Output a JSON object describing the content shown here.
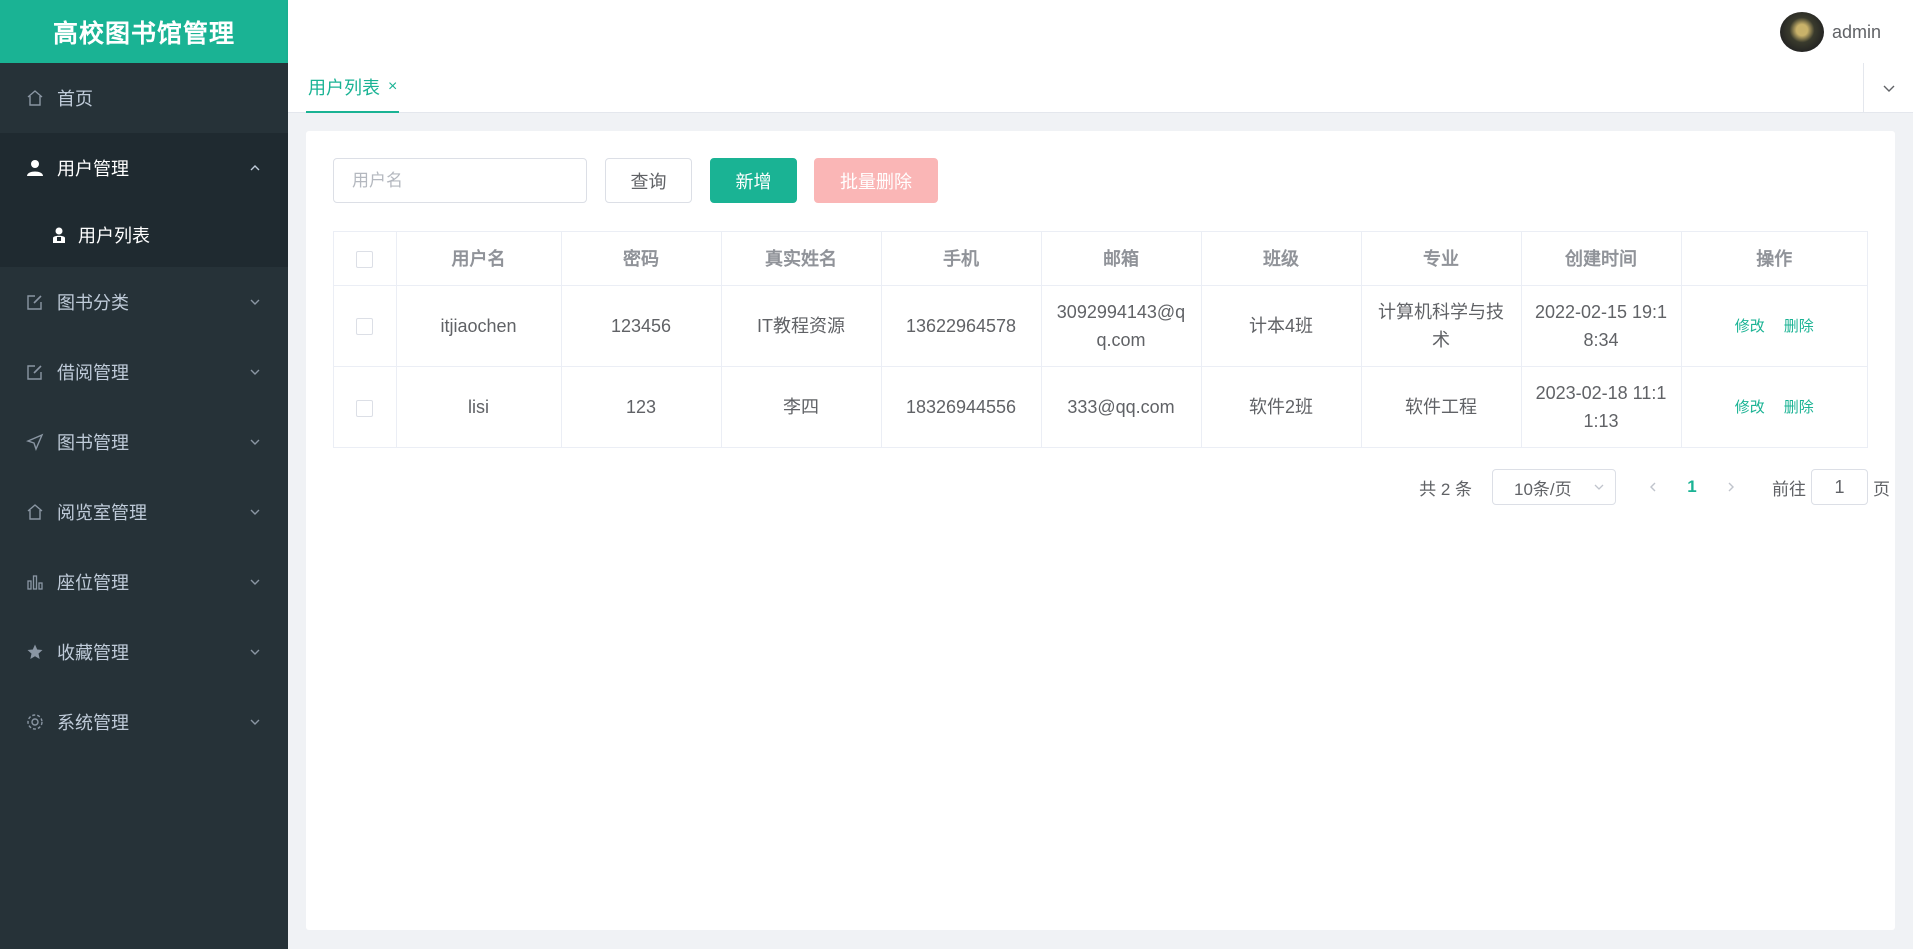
{
  "app": {
    "title": "高校图书馆管理"
  },
  "header": {
    "username": "admin"
  },
  "sidebar": {
    "items": [
      {
        "label": "首页",
        "icon": "home-icon"
      },
      {
        "label": "用户管理",
        "icon": "user-icon",
        "sub": [
          {
            "label": "用户列表",
            "icon": "user-list-icon"
          }
        ]
      },
      {
        "label": "图书分类",
        "icon": "edit-icon"
      },
      {
        "label": "借阅管理",
        "icon": "edit-icon"
      },
      {
        "label": "图书管理",
        "icon": "send-icon"
      },
      {
        "label": "阅览室管理",
        "icon": "home-icon"
      },
      {
        "label": "座位管理",
        "icon": "bar-chart-icon"
      },
      {
        "label": "收藏管理",
        "icon": "star-icon"
      },
      {
        "label": "系统管理",
        "icon": "gear-icon"
      }
    ]
  },
  "tabs": [
    {
      "label": "用户列表",
      "close": "×"
    }
  ],
  "toolbar": {
    "search_placeholder": "用户名",
    "query_label": "查询",
    "add_label": "新增",
    "batch_delete_label": "批量删除"
  },
  "table": {
    "columns": [
      "用户名",
      "密码",
      "真实姓名",
      "手机",
      "邮箱",
      "班级",
      "专业",
      "创建时间",
      "操作"
    ],
    "rows": [
      {
        "username": "itjiaochen",
        "password": "123456",
        "realname": "IT教程资源",
        "phone": "13622964578",
        "email": "3092994143@qq.com",
        "class": "计本4班",
        "major": "计算机科学与技术",
        "created": "2022-02-15 19:18:34"
      },
      {
        "username": "lisi",
        "password": "123",
        "realname": "李四",
        "phone": "18326944556",
        "email": "333@qq.com",
        "class": "软件2班",
        "major": "软件工程",
        "created": "2023-02-18 11:11:13"
      }
    ],
    "actions": {
      "edit": "修改",
      "delete": "删除"
    }
  },
  "pagination": {
    "total": "共 2 条",
    "page_size": "10条/页",
    "current": "1",
    "goto_prefix": "前往",
    "goto_value": "1",
    "goto_suffix": "页"
  },
  "colors": {
    "brand": "#1ab394",
    "sidebar_bg": "#263238",
    "danger_light": "#fab6b6"
  }
}
